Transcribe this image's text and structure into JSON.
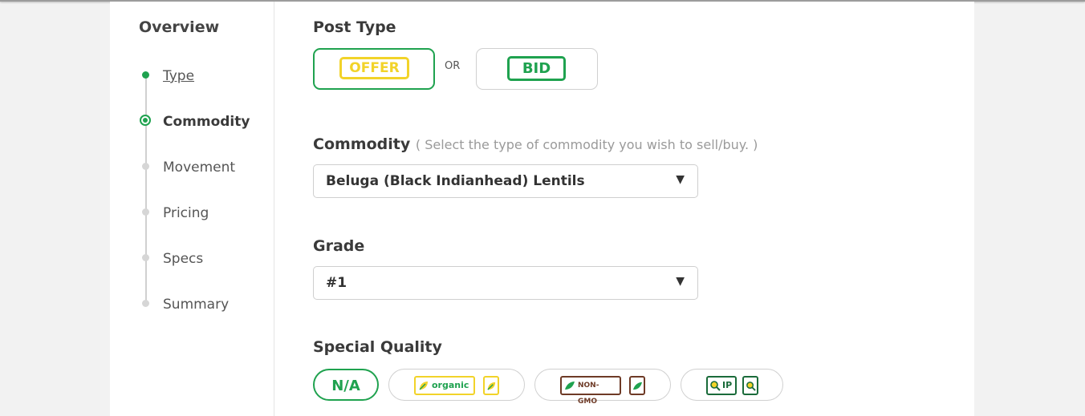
{
  "sidebar": {
    "title": "Overview",
    "steps": [
      {
        "label": "Type",
        "state": "done"
      },
      {
        "label": "Commodity",
        "state": "current"
      },
      {
        "label": "Movement",
        "state": "todo"
      },
      {
        "label": "Pricing",
        "state": "todo"
      },
      {
        "label": "Specs",
        "state": "todo"
      },
      {
        "label": "Summary",
        "state": "todo"
      }
    ]
  },
  "post_type": {
    "label": "Post Type",
    "offer": "OFFER",
    "or": "OR",
    "bid": "BID",
    "selected": "OFFER"
  },
  "commodity": {
    "label": "Commodity",
    "hint": "( Select the type of commodity you wish to sell/buy. )",
    "value": "Beluga (Black Indianhead) Lentils"
  },
  "grade": {
    "label": "Grade",
    "value": "#1"
  },
  "special_quality": {
    "label": "Special Quality",
    "options": [
      "N/A",
      "organic",
      "NON-GMO",
      "IP"
    ],
    "selected": "N/A"
  },
  "colors": {
    "green": "#1fa24f",
    "yellow": "#f2d329",
    "brown": "#6e3a26",
    "dark_green": "#1a6b3a"
  },
  "icons": [
    "leaf-icon",
    "magnifier-icon",
    "dropdown-caret-icon"
  ]
}
